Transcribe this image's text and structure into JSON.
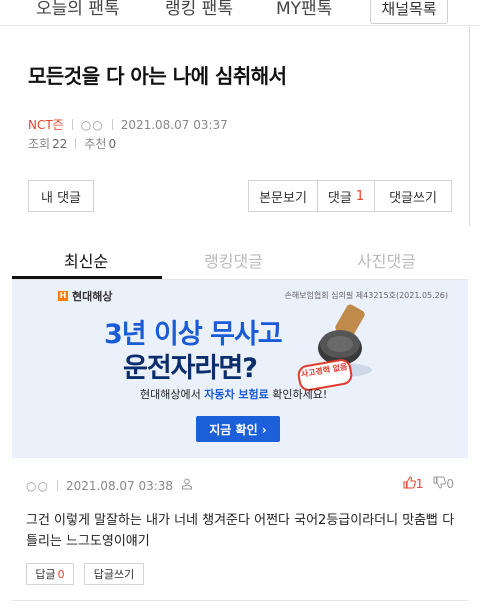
{
  "topnav": {
    "items": [
      "오늘의 팬톡",
      "랭킹 팬톡",
      "MY팬톡"
    ],
    "channel_list": "채널목록"
  },
  "post": {
    "title": "모든것을 다 아는 나에 심취해서",
    "author": "NCT즌",
    "author_id_mask": "○○",
    "datetime": "2021.08.07 03:37",
    "views_label": "조회",
    "views": "22",
    "recommend_label": "추천",
    "recommend": "0"
  },
  "actions": {
    "my_comment": "내 댓글",
    "view_body": "본문보기",
    "comment_label": "댓글",
    "comment_count": "1",
    "write_comment": "댓글쓰기"
  },
  "tabs": [
    "최신순",
    "랭킹댓글",
    "사진댓글"
  ],
  "ad": {
    "brand": "현대해상",
    "brand_mark": "H",
    "approval": "손해보험협회 심의필 제43215호(2021.05.26)",
    "line1": "3년 이상 무사고",
    "line2": "운전자라면?",
    "stamp_text": "사고경력 없음",
    "sub_pre": "현대해상에서 ",
    "sub_highlight": "자동차 보험료",
    "sub_post": " 확인하세요!",
    "cta": "지금 확인 ›"
  },
  "comment": {
    "author_id_mask": "○○",
    "datetime": "2021.08.07 03:38",
    "upvotes": "1",
    "downvotes": "0",
    "text": "그건 이렇게 말잘하는 내가 너네 챙겨준다 어쩐다 국어2등급이라더니 맛춤뻡 다틀리는 느그도영이얘기",
    "reply_label": "답글",
    "reply_count": "0",
    "write_reply": "답글쓰기"
  },
  "colors": {
    "accent_red": "#e8452c",
    "ad_blue": "#1b5cd6",
    "ad_navy": "#0b2d6b",
    "ad_bg": "#eaf1fb"
  }
}
